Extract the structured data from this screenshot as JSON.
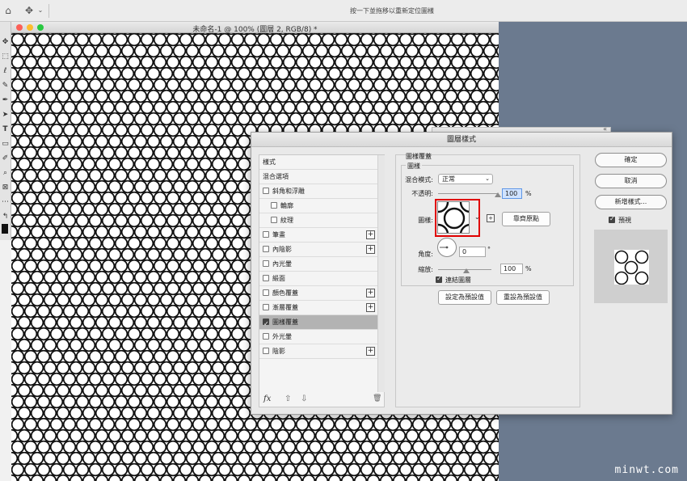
{
  "options_bar": {
    "hint": "按一下並拖移以重新定位圖樣",
    "home_icon": "home-icon",
    "move_icon": "move-tool-icon"
  },
  "document": {
    "title": "未命名-1 @ 100% (圖層 2, RGB/8) *",
    "traffic_colors": [
      "#fc5f57",
      "#fdbc2e",
      "#28c840"
    ]
  },
  "dialog": {
    "title": "圖層樣式",
    "list": {
      "header": "樣式",
      "blend_options": "混合選項",
      "items": [
        {
          "label": "斜角和浮雕",
          "checked": false,
          "plus": false,
          "indent": false
        },
        {
          "label": "輪廓",
          "checked": false,
          "plus": false,
          "indent": true
        },
        {
          "label": "紋理",
          "checked": false,
          "plus": false,
          "indent": true
        },
        {
          "label": "筆畫",
          "checked": false,
          "plus": true,
          "indent": false
        },
        {
          "label": "內陰影",
          "checked": false,
          "plus": true,
          "indent": false
        },
        {
          "label": "內光暈",
          "checked": false,
          "plus": false,
          "indent": false
        },
        {
          "label": "緞面",
          "checked": false,
          "plus": false,
          "indent": false
        },
        {
          "label": "顏色覆蓋",
          "checked": false,
          "plus": true,
          "indent": false
        },
        {
          "label": "漸層覆蓋",
          "checked": false,
          "plus": true,
          "indent": false
        },
        {
          "label": "圖樣覆蓋",
          "checked": true,
          "plus": false,
          "indent": false,
          "selected": true
        },
        {
          "label": "外光暈",
          "checked": false,
          "plus": false,
          "indent": false
        },
        {
          "label": "陰影",
          "checked": false,
          "plus": true,
          "indent": false
        }
      ],
      "footer": {
        "fx": "fx",
        "up": "⇧",
        "down": "⇩",
        "trash": "🗑"
      }
    },
    "pattern_overlay": {
      "section_title": "圖樣覆蓋",
      "group_title": "圖樣",
      "blend_mode_label": "混合模式:",
      "blend_mode_value": "正常",
      "opacity_label": "不透明:",
      "opacity_value": "100",
      "opacity_unit": "%",
      "opacity_level": 1.0,
      "pattern_label": "圖樣:",
      "snap_button": "靠齊原點",
      "angle_label": "角度:",
      "angle_value": "0",
      "angle_unit": "°",
      "scale_label": "縮放:",
      "scale_value": "100",
      "scale_unit": "%",
      "link_label": "連結圖層",
      "link_checked": true,
      "set_default_button": "設定為預設值",
      "reset_default_button": "重設為預設值"
    },
    "right": {
      "ok_button": "確定",
      "cancel_button": "取消",
      "new_style_button": "新增樣式...",
      "preview_label": "預視",
      "preview_checked": true
    }
  },
  "watermark": "minwt.com"
}
